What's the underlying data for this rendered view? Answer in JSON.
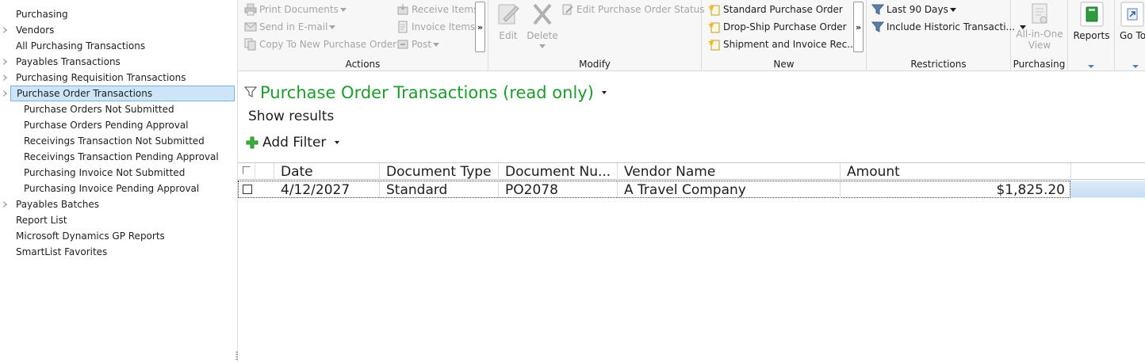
{
  "navigation": {
    "items": [
      {
        "label": "Purchasing",
        "level": 0,
        "expandable": false,
        "selected": false
      },
      {
        "label": "Vendors",
        "level": 0,
        "expandable": true,
        "selected": false
      },
      {
        "label": "All Purchasing Transactions",
        "level": 0,
        "expandable": false,
        "selected": false
      },
      {
        "label": "Payables Transactions",
        "level": 0,
        "expandable": true,
        "selected": false
      },
      {
        "label": "Purchasing Requisition Transactions",
        "level": 0,
        "expandable": true,
        "selected": false
      },
      {
        "label": "Purchase Order Transactions",
        "level": 0,
        "expandable": true,
        "selected": true
      },
      {
        "label": "Purchase Orders Not Submitted",
        "level": 1,
        "expandable": false,
        "selected": false
      },
      {
        "label": "Purchase Orders Pending Approval",
        "level": 1,
        "expandable": false,
        "selected": false
      },
      {
        "label": "Receivings Transaction Not Submitted",
        "level": 1,
        "expandable": false,
        "selected": false
      },
      {
        "label": "Receivings Transaction Pending Approval",
        "level": 1,
        "expandable": false,
        "selected": false
      },
      {
        "label": "Purchasing Invoice Not Submitted",
        "level": 1,
        "expandable": false,
        "selected": false
      },
      {
        "label": "Purchasing Invoice Pending Approval",
        "level": 1,
        "expandable": false,
        "selected": false
      },
      {
        "label": "Payables Batches",
        "level": 0,
        "expandable": true,
        "selected": false
      },
      {
        "label": "Report List",
        "level": 0,
        "expandable": false,
        "selected": false
      },
      {
        "label": "Microsoft Dynamics GP Reports",
        "level": 0,
        "expandable": false,
        "selected": false
      },
      {
        "label": "SmartList Favorites",
        "level": 0,
        "expandable": false,
        "selected": false
      }
    ]
  },
  "ribbon": {
    "actions": {
      "label": "Actions",
      "print_documents": "Print Documents",
      "send_in_email": "Send in E-mail",
      "copy_to_new_po": "Copy To New Purchase Order",
      "receive_items": "Receive Items",
      "invoice_items": "Invoice Items",
      "post": "Post",
      "more": "»"
    },
    "modify": {
      "label": "Modify",
      "edit": "Edit",
      "delete": "Delete",
      "edit_po_status": "Edit Purchase Order Status"
    },
    "new": {
      "label": "New",
      "standard_po": "Standard Purchase Order",
      "drop_ship_po": "Drop-Ship Purchase Order",
      "shipment_invoice": "Shipment and Invoice Rec...",
      "more": "»"
    },
    "restrictions": {
      "label": "Restrictions",
      "date_range": "Last 90 Days",
      "historic": "Include Historic Transacti..."
    },
    "purchasing": {
      "label": "Purchasing",
      "all_in_one": "All-in-One View"
    },
    "reports": {
      "label": "Reports"
    },
    "goto": {
      "label": "Go To"
    }
  },
  "list": {
    "title": "Purchase Order Transactions (read only)",
    "show_results": "Show results",
    "add_filter": "Add Filter",
    "columns": [
      "Date",
      "Document Type",
      "Document Nu...",
      "Vendor Name",
      "Amount"
    ],
    "rows": [
      {
        "date": "4/12/2027",
        "document_type": "Standard",
        "document_number": "PO2078",
        "vendor_name": "A Travel Company",
        "amount": "$1,825.20"
      }
    ]
  },
  "colors": {
    "title_green": "#1e9a2e",
    "selection_blue": "#cde6f7",
    "disabled_gray": "#a5a5a5"
  }
}
